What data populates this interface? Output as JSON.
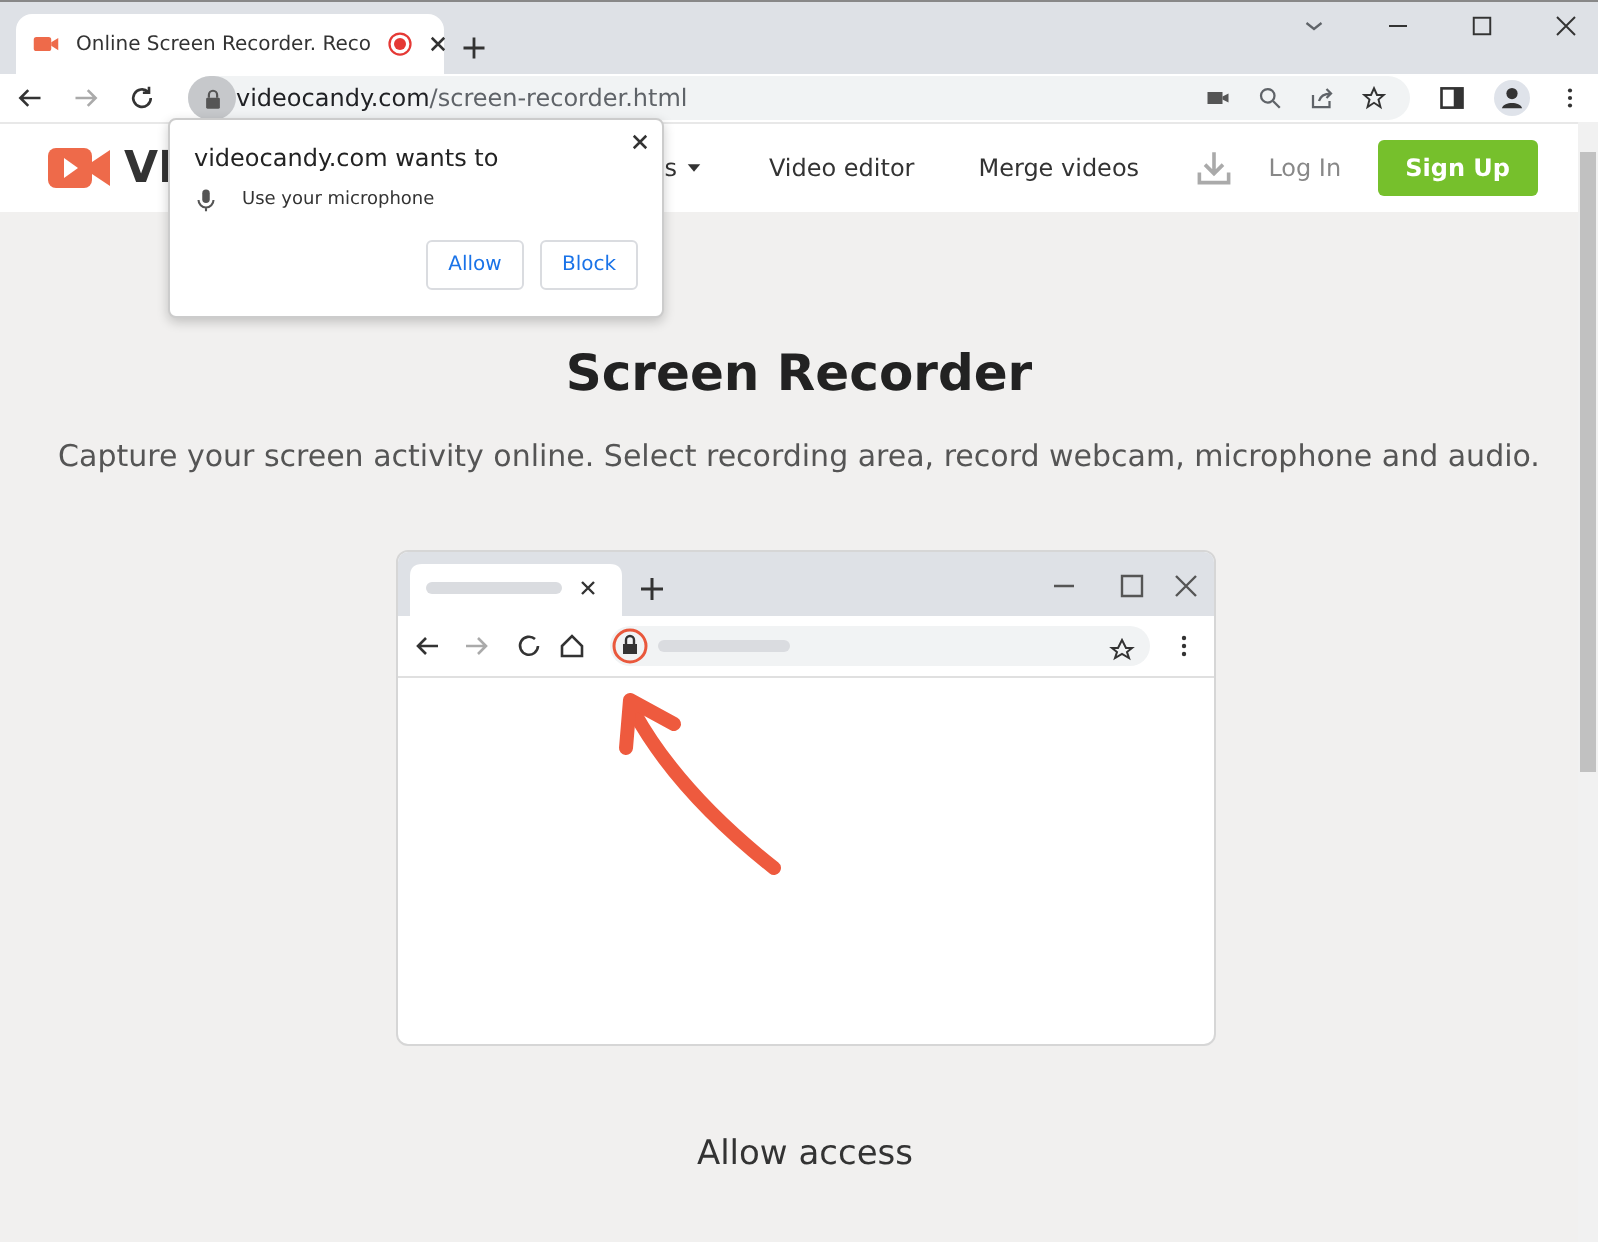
{
  "browser": {
    "tab": {
      "title": "Online Screen Recorder. Reco",
      "selected": true
    },
    "url_host": "videocandy.com",
    "url_path": "/screen-recorder.html"
  },
  "site_header": {
    "logo_text": "VI",
    "nav": [
      {
        "label": "s",
        "dropdown": true
      },
      {
        "label": "Video editor",
        "dropdown": false
      },
      {
        "label": "Merge videos",
        "dropdown": false
      }
    ],
    "login": "Log In",
    "signup": "Sign Up"
  },
  "permission_popup": {
    "title": "videocandy.com wants to",
    "permission": "Use your microphone",
    "buttons": [
      "Allow",
      "Block"
    ]
  },
  "page": {
    "title": "Screen Recorder",
    "subtitle": "Capture your screen activity online. Select recording area, record webcam, microphone and audio.",
    "step": "Allow access"
  }
}
